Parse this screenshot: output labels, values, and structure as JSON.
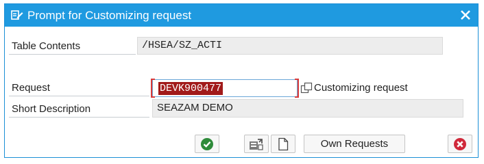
{
  "window": {
    "title": "Prompt for Customizing request",
    "icon": "edit-icon",
    "close_icon": "close-icon"
  },
  "fields": {
    "table_contents": {
      "label": "Table Contents",
      "value": "/HSEA/SZ_ACTI"
    },
    "request": {
      "label": "Request",
      "value": "DEVK900477",
      "f4_icon": "value-help-icon",
      "description": "Customizing request"
    },
    "short_description": {
      "label": "Short Description",
      "value": "SEAZAM DEMO"
    }
  },
  "toolbar": {
    "confirm_icon": "check-icon",
    "create_icon": "create-request-icon",
    "new_icon": "new-document-icon",
    "own_requests_label": "Own Requests",
    "cancel_icon": "cancel-icon"
  },
  "colors": {
    "title_bar": "#1f9ae0",
    "confirm": "#2e8b3a",
    "cancel": "#d0283a",
    "highlight": "#a11a1a"
  }
}
